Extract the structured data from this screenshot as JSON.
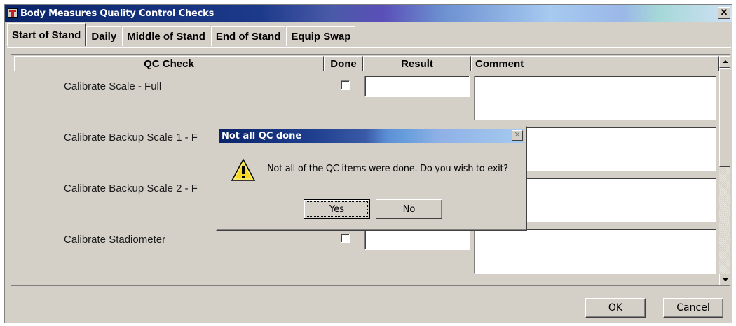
{
  "window": {
    "title": "Body Measures Quality Control Checks",
    "close_glyph": "✕"
  },
  "tabs": [
    {
      "label": "Start of Stand",
      "active": true
    },
    {
      "label": "Daily",
      "active": false
    },
    {
      "label": "Middle of Stand",
      "active": false
    },
    {
      "label": "End of Stand",
      "active": false
    },
    {
      "label": "Equip Swap",
      "active": false
    }
  ],
  "table": {
    "headers": {
      "qc_check": "QC Check",
      "done": "Done",
      "result": "Result",
      "comment": "Comment"
    },
    "rows": [
      {
        "label": "Calibrate Scale - Full",
        "done": false,
        "result": "",
        "comment": ""
      },
      {
        "label": "Calibrate Backup Scale 1 - F",
        "done": false,
        "result": "",
        "comment": ""
      },
      {
        "label": "Calibrate Backup Scale 2 - F",
        "done": false,
        "result": "",
        "comment": ""
      },
      {
        "label": "Calibrate Stadiometer",
        "done": false,
        "result": "",
        "comment": ""
      }
    ]
  },
  "footer": {
    "ok_label": "OK",
    "cancel_label": "Cancel"
  },
  "dialog": {
    "title": "Not all QC done",
    "message": "Not all of the QC items were done. Do you wish to exit?",
    "yes_label": "Yes",
    "no_label": "No",
    "icon": "warning-icon",
    "close_glyph": "✕"
  },
  "colors": {
    "face": "#d4d0c8",
    "titlebar_dark": "#0a246a",
    "warning_yellow": "#f8d820"
  }
}
